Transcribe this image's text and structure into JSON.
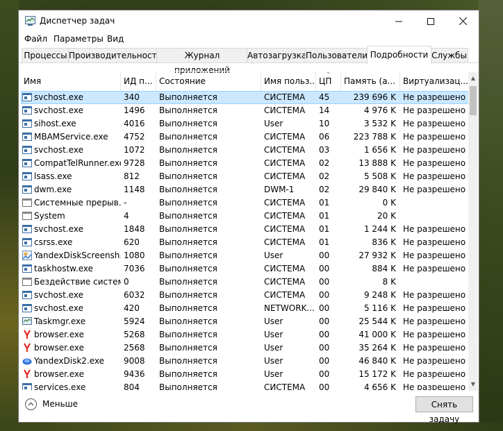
{
  "window": {
    "title": "Диспетчер задач"
  },
  "menu": [
    "Файл",
    "Параметры",
    "Вид"
  ],
  "tabs": [
    "Процессы",
    "Производительность",
    "Журнал приложений",
    "Автозагрузка",
    "Пользователи",
    "Подробности",
    "Службы"
  ],
  "active_tab": "Подробности",
  "columns": [
    "Имя",
    "ИД п...",
    "Состояние",
    "Имя польз...",
    "ЦП",
    "Память (а...",
    "Виртуализац..."
  ],
  "processes": [
    {
      "name": "svchost.exe",
      "pid": "340",
      "status": "Выполняется",
      "user": "СИСТЕМА",
      "cpu": "45",
      "mem": "239 696 K",
      "virt": "Не разрешено",
      "icon": "service-icon"
    },
    {
      "name": "svchost.exe",
      "pid": "1496",
      "status": "Выполняется",
      "user": "СИСТЕМА",
      "cpu": "14",
      "mem": "4 976 K",
      "virt": "Не разрешено",
      "icon": "service-icon"
    },
    {
      "name": "sihost.exe",
      "pid": "4016",
      "status": "Выполняется",
      "user": "User",
      "cpu": "10",
      "mem": "3 532 K",
      "virt": "Не разрешено",
      "icon": "service-icon"
    },
    {
      "name": "MBAMService.exe",
      "pid": "4752",
      "status": "Выполняется",
      "user": "СИСТЕМА",
      "cpu": "06",
      "mem": "223 788 K",
      "virt": "Не разрешено",
      "icon": "service-icon"
    },
    {
      "name": "svchost.exe",
      "pid": "1072",
      "status": "Выполняется",
      "user": "СИСТЕМА",
      "cpu": "03",
      "mem": "1 656 K",
      "virt": "Не разрешено",
      "icon": "service-icon"
    },
    {
      "name": "CompatTelRunner.exe",
      "pid": "9728",
      "status": "Выполняется",
      "user": "СИСТЕМА",
      "cpu": "02",
      "mem": "13 888 K",
      "virt": "Не разрешено",
      "icon": "service-icon"
    },
    {
      "name": "lsass.exe",
      "pid": "812",
      "status": "Выполняется",
      "user": "СИСТЕМА",
      "cpu": "02",
      "mem": "5 508 K",
      "virt": "Не разрешено",
      "icon": "service-icon"
    },
    {
      "name": "dwm.exe",
      "pid": "1148",
      "status": "Выполняется",
      "user": "DWM-1",
      "cpu": "02",
      "mem": "29 840 K",
      "virt": "Не разрешено",
      "icon": "service-icon"
    },
    {
      "name": "Системные прерыв...",
      "pid": "-",
      "status": "Выполняется",
      "user": "СИСТЕМА",
      "cpu": "01",
      "mem": "0 K",
      "virt": "",
      "icon": "system-icon"
    },
    {
      "name": "System",
      "pid": "4",
      "status": "Выполняется",
      "user": "СИСТЕМА",
      "cpu": "01",
      "mem": "20 K",
      "virt": "",
      "icon": "system-icon"
    },
    {
      "name": "svchost.exe",
      "pid": "1848",
      "status": "Выполняется",
      "user": "СИСТЕМА",
      "cpu": "01",
      "mem": "1 244 K",
      "virt": "Не разрешено",
      "icon": "service-icon"
    },
    {
      "name": "csrss.exe",
      "pid": "620",
      "status": "Выполняется",
      "user": "СИСТЕМА",
      "cpu": "01",
      "mem": "836 K",
      "virt": "Не разрешено",
      "icon": "service-icon"
    },
    {
      "name": "YandexDiskScreensh...",
      "pid": "1080",
      "status": "Выполняется",
      "user": "User",
      "cpu": "00",
      "mem": "27 932 K",
      "virt": "Не разрешено",
      "icon": "yandex-screenshot-icon"
    },
    {
      "name": "taskhostw.exe",
      "pid": "7036",
      "status": "Выполняется",
      "user": "СИСТЕМА",
      "cpu": "00",
      "mem": "884 K",
      "virt": "Не разрешено",
      "icon": "service-icon"
    },
    {
      "name": "Бездействие системы",
      "pid": "0",
      "status": "Выполняется",
      "user": "СИСТЕМА",
      "cpu": "00",
      "mem": "8 K",
      "virt": "",
      "icon": "system-icon"
    },
    {
      "name": "svchost.exe",
      "pid": "6032",
      "status": "Выполняется",
      "user": "СИСТЕМА",
      "cpu": "00",
      "mem": "9 248 K",
      "virt": "Не разрешено",
      "icon": "service-icon"
    },
    {
      "name": "svchost.exe",
      "pid": "420",
      "status": "Выполняется",
      "user": "NETWORK...",
      "cpu": "00",
      "mem": "5 116 K",
      "virt": "Не разрешено",
      "icon": "service-icon"
    },
    {
      "name": "Taskmgr.exe",
      "pid": "5924",
      "status": "Выполняется",
      "user": "User",
      "cpu": "00",
      "mem": "25 544 K",
      "virt": "Не разрешено",
      "icon": "taskmgr-icon"
    },
    {
      "name": "browser.exe",
      "pid": "5268",
      "status": "Выполняется",
      "user": "User",
      "cpu": "00",
      "mem": "41 000 K",
      "virt": "Не разрешено",
      "icon": "yandex-browser-icon"
    },
    {
      "name": "browser.exe",
      "pid": "2568",
      "status": "Выполняется",
      "user": "User",
      "cpu": "00",
      "mem": "35 264 K",
      "virt": "Не разрешено",
      "icon": "yandex-browser-icon"
    },
    {
      "name": "YandexDisk2.exe",
      "pid": "9008",
      "status": "Выполняется",
      "user": "User",
      "cpu": "00",
      "mem": "46 840 K",
      "virt": "Не разрешено",
      "icon": "yandex-disk-icon"
    },
    {
      "name": "browser.exe",
      "pid": "9436",
      "status": "Выполняется",
      "user": "User",
      "cpu": "00",
      "mem": "15 172 K",
      "virt": "Не разрешено",
      "icon": "yandex-browser-icon"
    },
    {
      "name": "services.exe",
      "pid": "804",
      "status": "Выполняется",
      "user": "СИСТЕМА",
      "cpu": "00",
      "mem": "4 656 K",
      "virt": "Не разрешено",
      "icon": "service-icon"
    }
  ],
  "footer": {
    "less_label": "Меньше",
    "end_task_label": "Снять задачу"
  },
  "colors": {
    "selected_row": "#cce8ff",
    "selected_border": "#99d1ff",
    "yandex_red": "#e52620"
  }
}
